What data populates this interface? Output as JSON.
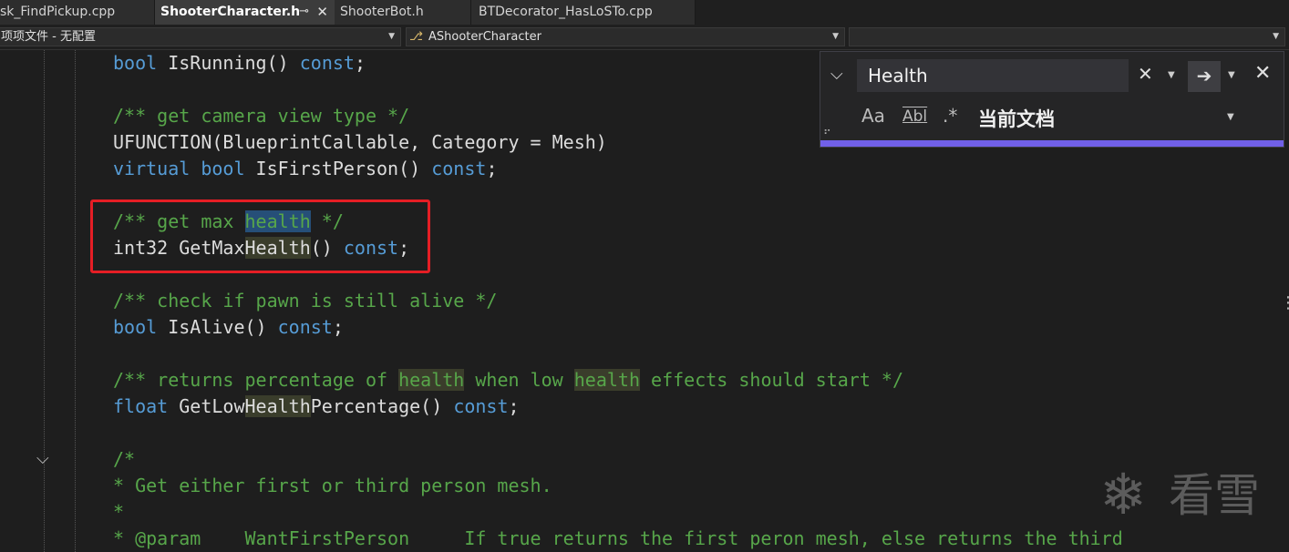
{
  "tabs": [
    {
      "label": "sk_FindPickup.cpp",
      "active": false
    },
    {
      "label": "ShooterCharacter.h",
      "active": true,
      "pin_icon": "⊸",
      "close_icon": "✕"
    },
    {
      "label": "ShooterBot.h",
      "active": false
    },
    {
      "label": "BTDecorator_HasLoSTo.cpp",
      "active": false
    }
  ],
  "nav": {
    "project_scope": "项项文件 - 无配置",
    "class_icon": "class-icon",
    "class_name": "AShooterCharacter",
    "member": ""
  },
  "code": [
    [
      {
        "t": "bool",
        "c": "kw"
      },
      {
        "t": " IsRunning",
        "c": "tx"
      },
      {
        "t": "()",
        "c": "tx"
      },
      {
        "t": " ",
        "c": "tx"
      },
      {
        "t": "const",
        "c": "kw"
      },
      {
        "t": ";",
        "c": "tx"
      }
    ],
    [],
    [
      {
        "t": "/** get camera view type */",
        "c": "cm"
      }
    ],
    [
      {
        "t": "UFUNCTION(BlueprintCallable, Category = Mesh)",
        "c": "tx"
      }
    ],
    [
      {
        "t": "virtual",
        "c": "kw"
      },
      {
        "t": " ",
        "c": "tx"
      },
      {
        "t": "bool",
        "c": "kw"
      },
      {
        "t": " IsFirstPerson() ",
        "c": "tx"
      },
      {
        "t": "const",
        "c": "kw"
      },
      {
        "t": ";",
        "c": "tx"
      }
    ],
    [],
    [
      {
        "t": "/** get max ",
        "c": "cm"
      },
      {
        "t": "health",
        "c": "cm",
        "h": "sel"
      },
      {
        "t": " */",
        "c": "cm"
      }
    ],
    [
      {
        "t": "int32 GetMax",
        "c": "tx"
      },
      {
        "t": "Health",
        "c": "tx",
        "h": "find"
      },
      {
        "t": "() ",
        "c": "tx"
      },
      {
        "t": "const",
        "c": "kw"
      },
      {
        "t": ";",
        "c": "tx"
      }
    ],
    [],
    [
      {
        "t": "/** check if pawn is still alive */",
        "c": "cm"
      }
    ],
    [
      {
        "t": "bool",
        "c": "kw"
      },
      {
        "t": " IsAlive() ",
        "c": "tx"
      },
      {
        "t": "const",
        "c": "kw"
      },
      {
        "t": ";",
        "c": "tx"
      }
    ],
    [],
    [
      {
        "t": "/** returns percentage of ",
        "c": "cm"
      },
      {
        "t": "health",
        "c": "cm",
        "h": "find"
      },
      {
        "t": " when low ",
        "c": "cm"
      },
      {
        "t": "health",
        "c": "cm",
        "h": "find"
      },
      {
        "t": " effects should start */",
        "c": "cm"
      }
    ],
    [
      {
        "t": "float",
        "c": "kw"
      },
      {
        "t": " GetLow",
        "c": "tx"
      },
      {
        "t": "Health",
        "c": "tx",
        "h": "find"
      },
      {
        "t": "Percentage() ",
        "c": "tx"
      },
      {
        "t": "const",
        "c": "kw"
      },
      {
        "t": ";",
        "c": "tx"
      }
    ],
    [],
    [
      {
        "t": "/*",
        "c": "cm"
      }
    ],
    [
      {
        "t": "* Get either first or third person mesh.",
        "c": "cm"
      }
    ],
    [
      {
        "t": "*",
        "c": "cm"
      }
    ],
    [
      {
        "t": "* @param    WantFirstPerson     If true returns the first peron mesh, else returns the third",
        "c": "cm"
      }
    ]
  ],
  "find": {
    "query": "Health",
    "clear_icon": "✕",
    "next_icon": "➔",
    "close_icon": "✕",
    "collapse_icon": "chevron-down-icon",
    "match_case_label": "Aa",
    "whole_word_label": "Abl",
    "regex_label": ".*",
    "scope": "当前文档"
  },
  "watermark": {
    "text": "看雪",
    "icon": "snowflake-icon"
  },
  "colors": {
    "background": "#1e1e1e",
    "keyword": "#569cd6",
    "comment": "#57a64a",
    "text": "#dcdcdc",
    "find_accent": "#7160e8",
    "annotation_box": "#e51e25"
  }
}
